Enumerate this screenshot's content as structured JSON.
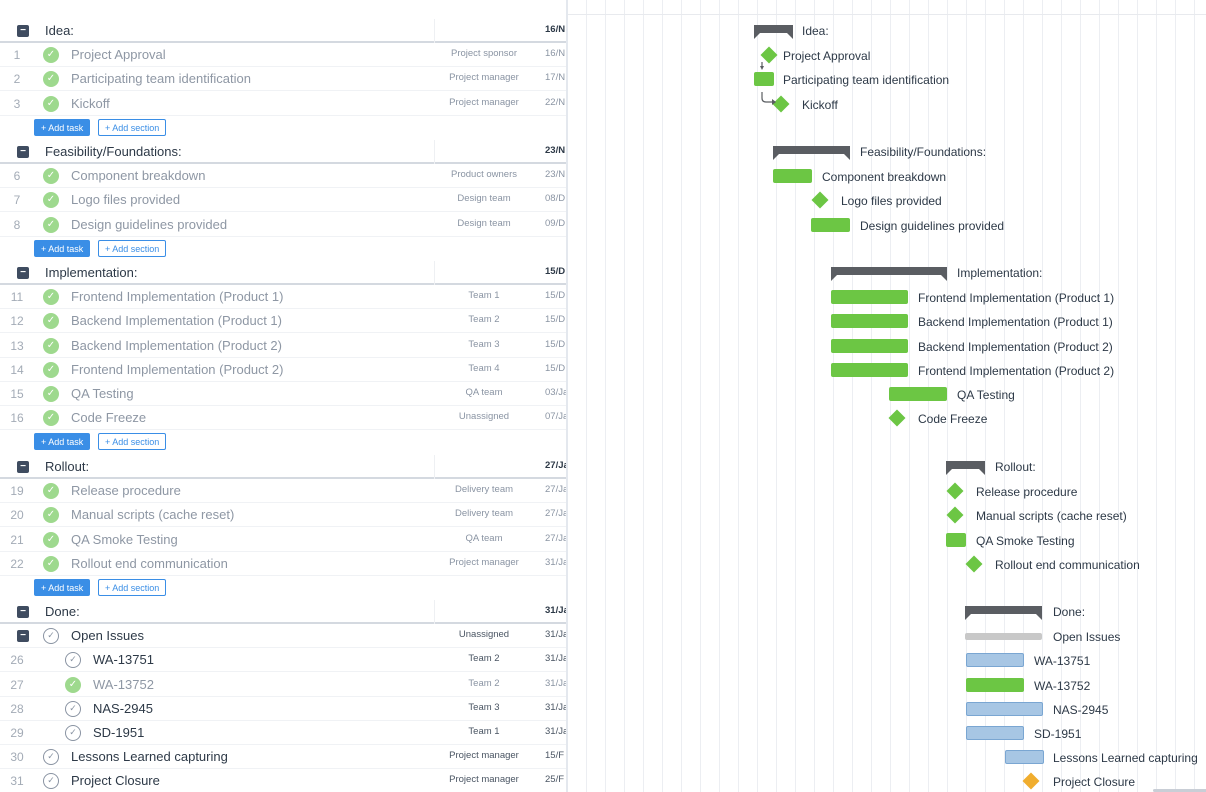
{
  "buttons": {
    "add_task": "+ Add task",
    "add_section": "+ Add section"
  },
  "colors": {
    "complete": "#6cc644",
    "in_progress": "#a7c6e4",
    "milestone_done": "#6cc644",
    "milestone_pending": "#f0ad2e",
    "accent": "#3a8ee6"
  },
  "sections": [
    {
      "name": "Idea:",
      "date": "16/N",
      "tasks": [
        {
          "num": "1",
          "name": "Project Approval",
          "assignee": "Project sponsor",
          "date": "16/N",
          "status": "done",
          "type": "milestone"
        },
        {
          "num": "2",
          "name": "Participating team identification",
          "assignee": "Project manager",
          "date": "17/N",
          "status": "done",
          "type": "bar"
        },
        {
          "num": "3",
          "name": "Kickoff",
          "assignee": "Project manager",
          "date": "22/N",
          "status": "done",
          "type": "milestone"
        }
      ]
    },
    {
      "name": "Feasibility/Foundations:",
      "date": "23/N",
      "tasks": [
        {
          "num": "6",
          "name": "Component breakdown",
          "assignee": "Product owners",
          "date": "23/N",
          "status": "done",
          "type": "bar"
        },
        {
          "num": "7",
          "name": "Logo files provided",
          "assignee": "Design team",
          "date": "08/D",
          "status": "done",
          "type": "milestone"
        },
        {
          "num": "8",
          "name": "Design guidelines provided",
          "assignee": "Design team",
          "date": "09/D",
          "status": "done",
          "type": "bar"
        }
      ]
    },
    {
      "name": "Implementation:",
      "date": "15/D",
      "tasks": [
        {
          "num": "11",
          "name": "Frontend Implementation (Product 1)",
          "assignee": "Team 1",
          "date": "15/D",
          "status": "done",
          "type": "bar"
        },
        {
          "num": "12",
          "name": "Backend Implementation (Product 1)",
          "assignee": "Team 2",
          "date": "15/D",
          "status": "done",
          "type": "bar"
        },
        {
          "num": "13",
          "name": "Backend Implementation (Product 2)",
          "assignee": "Team 3",
          "date": "15/D",
          "status": "done",
          "type": "bar"
        },
        {
          "num": "14",
          "name": "Frontend Implementation (Product 2)",
          "assignee": "Team 4",
          "date": "15/D",
          "status": "done",
          "type": "bar"
        },
        {
          "num": "15",
          "name": "QA Testing",
          "assignee": "QA team",
          "date": "03/Ja",
          "status": "done",
          "type": "bar"
        },
        {
          "num": "16",
          "name": "Code Freeze",
          "assignee": "Unassigned",
          "date": "07/Ja",
          "status": "done",
          "type": "milestone"
        }
      ]
    },
    {
      "name": "Rollout:",
      "date": "27/Ja",
      "tasks": [
        {
          "num": "19",
          "name": "Release procedure",
          "assignee": "Delivery team",
          "date": "27/Ja",
          "status": "done",
          "type": "milestone"
        },
        {
          "num": "20",
          "name": "Manual scripts (cache reset)",
          "assignee": "Delivery team",
          "date": "27/Ja",
          "status": "done",
          "type": "milestone"
        },
        {
          "num": "21",
          "name": "QA Smoke Testing",
          "assignee": "QA team",
          "date": "27/Ja",
          "status": "done",
          "type": "bar"
        },
        {
          "num": "22",
          "name": "Rollout end communication",
          "assignee": "Project manager",
          "date": "31/Ja",
          "status": "done",
          "type": "milestone"
        }
      ]
    },
    {
      "name": "Done:",
      "date": "31/Ja",
      "tasks": [
        {
          "num": "",
          "name": "Open Issues",
          "assignee": "Unassigned",
          "date": "31/Ja",
          "status": "open",
          "type": "group"
        },
        {
          "num": "26",
          "name": "WA-13751",
          "assignee": "Team 2",
          "date": "31/Ja",
          "status": "open",
          "type": "bar"
        },
        {
          "num": "27",
          "name": "WA-13752",
          "assignee": "Team 2",
          "date": "31/Ja",
          "status": "done",
          "type": "bar"
        },
        {
          "num": "28",
          "name": "NAS-2945",
          "assignee": "Team 3",
          "date": "31/Ja",
          "status": "open",
          "type": "bar"
        },
        {
          "num": "29",
          "name": "SD-1951",
          "assignee": "Team 1",
          "date": "31/Ja",
          "status": "open",
          "type": "bar"
        },
        {
          "num": "30",
          "name": "Lessons Learned capturing",
          "assignee": "Project manager",
          "date": "15/F",
          "status": "open",
          "type": "bar"
        },
        {
          "num": "31",
          "name": "Project Closure",
          "assignee": "Project manager",
          "date": "25/F",
          "status": "open",
          "type": "milestone"
        }
      ]
    }
  ]
}
